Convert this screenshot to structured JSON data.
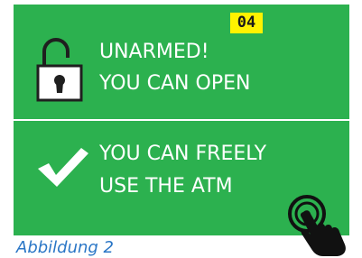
{
  "screen": {
    "background_color": "#2cb14f",
    "badge": {
      "text": "04",
      "color": "#fff200"
    },
    "status": {
      "icon": "unlocked-padlock-icon",
      "line1": "UNARMED!",
      "line2": "YOU CAN OPEN"
    },
    "atm": {
      "icon": "checkmark-icon",
      "line1": "YOU CAN FREELY",
      "line2": "USE THE ATM"
    }
  },
  "tap_indicator": {
    "icon": "tap-hand-icon"
  },
  "caption": {
    "text": "Abbildung 2",
    "color": "#2a76c6"
  }
}
